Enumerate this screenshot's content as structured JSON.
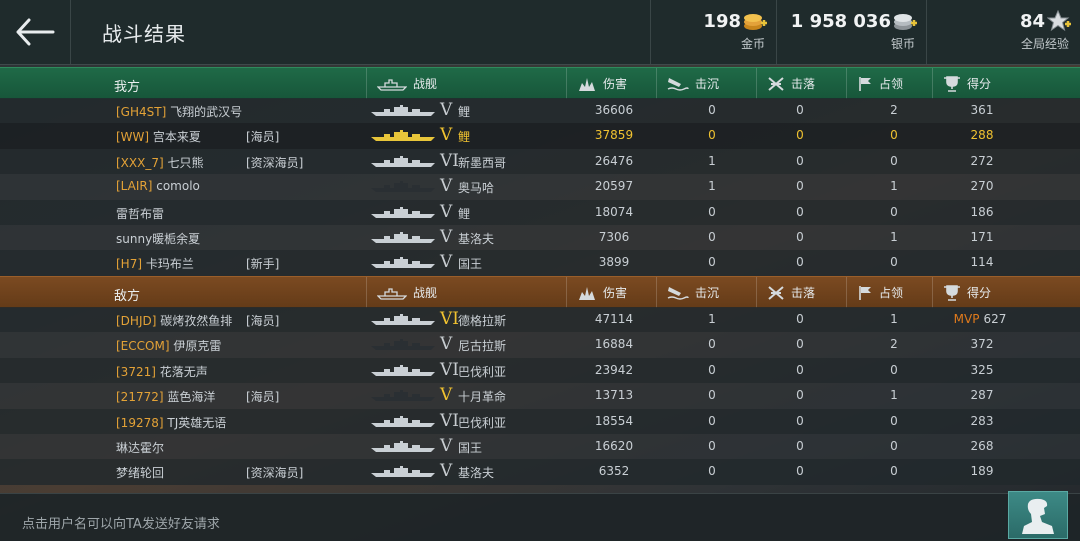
{
  "header": {
    "title": "战斗结果",
    "gold": {
      "value": "198",
      "label": "金币"
    },
    "silver": {
      "value": "1 958 036",
      "label": "银币"
    },
    "xp": {
      "value": "84",
      "label": "全局经验"
    }
  },
  "columns": {
    "ship": "战舰",
    "damage": "伤害",
    "sunk": "击沉",
    "shotdown": "击落",
    "capture": "占领",
    "score": "得分"
  },
  "ally": {
    "label": "我方",
    "rows": [
      {
        "clan": "[GH4ST]",
        "name": " 飞翔的武汉号",
        "badge": "",
        "tier": "V",
        "ship": "鲤",
        "damage": "36606",
        "sunk": "0",
        "shotdown": "0",
        "capture": "2",
        "score": "361",
        "mvp": ""
      },
      {
        "clan": "[WW]",
        "name": " 宫本来夏",
        "badge": "[海员]",
        "tier": "V",
        "ship": "鲤",
        "damage": "37859",
        "sunk": "0",
        "shotdown": "0",
        "capture": "0",
        "score": "288",
        "mvp": ""
      },
      {
        "clan": "[XXX_7]",
        "name": " 七只熊",
        "badge": "[资深海员]",
        "tier": "VI",
        "ship": "新墨西哥",
        "damage": "26476",
        "sunk": "1",
        "shotdown": "0",
        "capture": "0",
        "score": "272",
        "mvp": ""
      },
      {
        "clan": "[LAIR]",
        "name": " comolo",
        "badge": "",
        "tier": "V",
        "ship": "奥马哈",
        "damage": "20597",
        "sunk": "1",
        "shotdown": "0",
        "capture": "1",
        "score": "270",
        "mvp": ""
      },
      {
        "clan": "",
        "name": "雷哲布雷",
        "badge": "",
        "tier": "V",
        "ship": "鲤",
        "damage": "18074",
        "sunk": "0",
        "shotdown": "0",
        "capture": "0",
        "score": "186",
        "mvp": ""
      },
      {
        "clan": "",
        "name": "sunny暖栀余夏",
        "badge": "",
        "tier": "V",
        "ship": "基洛夫",
        "damage": "7306",
        "sunk": "0",
        "shotdown": "0",
        "capture": "1",
        "score": "171",
        "mvp": ""
      },
      {
        "clan": "[H7]",
        "name": " 卡玛布兰",
        "badge": "[新手]",
        "tier": "V",
        "ship": "国王",
        "damage": "3899",
        "sunk": "0",
        "shotdown": "0",
        "capture": "0",
        "score": "114",
        "mvp": ""
      }
    ]
  },
  "enemy": {
    "label": "敌方",
    "rows": [
      {
        "clan": "[DHJD]",
        "name": " 碳烤孜然鱼排",
        "badge": "[海员]",
        "tier": "VI",
        "ship": "德格拉斯",
        "damage": "47114",
        "sunk": "1",
        "shotdown": "0",
        "capture": "1",
        "score": "627",
        "mvp": "MVP"
      },
      {
        "clan": "[ECCOM]",
        "name": " 伊原克雷",
        "badge": "",
        "tier": "V",
        "ship": "尼古拉斯",
        "damage": "16884",
        "sunk": "0",
        "shotdown": "0",
        "capture": "2",
        "score": "372",
        "mvp": ""
      },
      {
        "clan": "[3721]",
        "name": " 花落无声",
        "badge": "",
        "tier": "VI",
        "ship": "巴伐利亚",
        "damage": "23942",
        "sunk": "0",
        "shotdown": "0",
        "capture": "0",
        "score": "325",
        "mvp": ""
      },
      {
        "clan": "[21772]",
        "name": " 蓝色海洋",
        "badge": "[海员]",
        "tier": "V",
        "ship": "十月革命",
        "damage": "13713",
        "sunk": "0",
        "shotdown": "0",
        "capture": "1",
        "score": "287",
        "mvp": ""
      },
      {
        "clan": "[19278]",
        "name": " TJ英雄无语",
        "badge": "",
        "tier": "VI",
        "ship": "巴伐利亚",
        "damage": "18554",
        "sunk": "0",
        "shotdown": "0",
        "capture": "0",
        "score": "283",
        "mvp": ""
      },
      {
        "clan": "",
        "name": "琳达霍尔",
        "badge": "",
        "tier": "V",
        "ship": "国王",
        "damage": "16620",
        "sunk": "0",
        "shotdown": "0",
        "capture": "0",
        "score": "268",
        "mvp": ""
      },
      {
        "clan": "",
        "name": "梦绪轮回",
        "badge": "[资深海员]",
        "tier": "V",
        "ship": "基洛夫",
        "damage": "6352",
        "sunk": "0",
        "shotdown": "0",
        "capture": "0",
        "score": "189",
        "mvp": ""
      }
    ]
  },
  "footer": {
    "hint": "点击用户名可以向TA发送好友请求"
  },
  "colors": {
    "accent_gold": "#f0c230",
    "clan_orange": "#e3a237",
    "ally_header": "#1f6a47",
    "enemy_header": "#7b4a21",
    "mvp": "#e07a1c"
  },
  "icons": [
    "back-arrow-icon",
    "gold-coins-icon",
    "silver-coins-icon",
    "xp-stars-icon",
    "battleship-icon",
    "damage-burst-icon",
    "sunk-ship-icon",
    "plane-shotdown-icon",
    "capture-flag-icon",
    "trophy-icon",
    "captain-silhouette-icon"
  ]
}
